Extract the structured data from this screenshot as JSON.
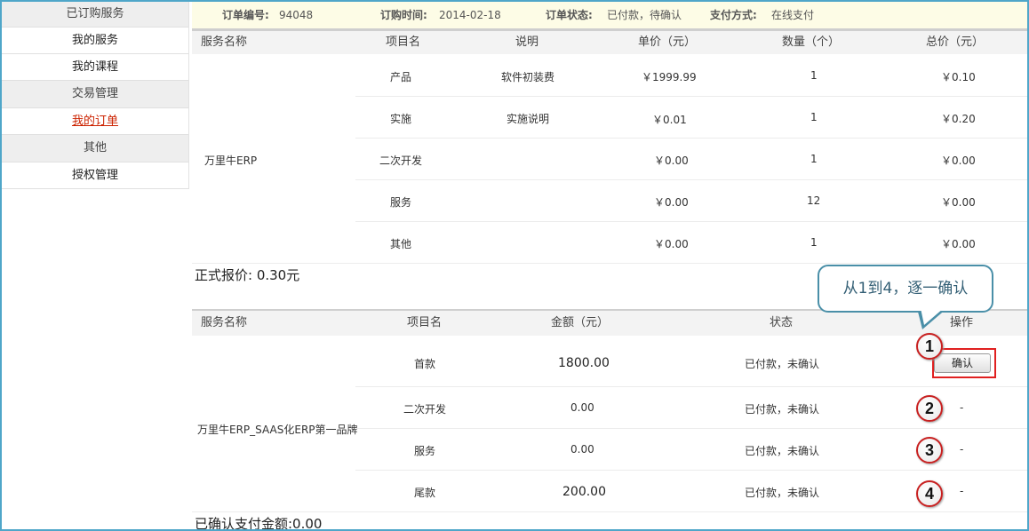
{
  "sidebar": {
    "groups": [
      {
        "title": "已订购服务",
        "items": [
          "我的服务",
          "我的课程"
        ]
      },
      {
        "title": "交易管理",
        "items": [
          "我的订单"
        ]
      },
      {
        "title": "其他",
        "items": [
          "授权管理"
        ]
      }
    ],
    "active_item": "我的订单"
  },
  "order": {
    "id_label": "订单编号:",
    "id": "94048",
    "date_label": "订购时间:",
    "date": "2014-02-18",
    "status_label": "订单状态:",
    "status": "已付款，待确认",
    "pay_label": "支付方式:",
    "pay": "在线支付"
  },
  "items_table": {
    "headers": [
      "服务名称",
      "项目名",
      "说明",
      "单价（元）",
      "数量（个）",
      "总价（元）"
    ],
    "service_name": "万里牛ERP",
    "rows": [
      {
        "item": "产品",
        "desc": "软件初装费",
        "price": "￥1999.99",
        "qty": "1",
        "total": "￥0.10"
      },
      {
        "item": "实施",
        "desc": "实施说明",
        "price": "￥0.01",
        "qty": "1",
        "total": "￥0.20"
      },
      {
        "item": "二次开发",
        "desc": "",
        "price": "￥0.00",
        "qty": "1",
        "total": "￥0.00"
      },
      {
        "item": "服务",
        "desc": "",
        "price": "￥0.00",
        "qty": "12",
        "total": "￥0.00"
      },
      {
        "item": "其他",
        "desc": "",
        "price": "￥0.00",
        "qty": "1",
        "total": "￥0.00"
      }
    ],
    "quote_text": "正式报价: 0.30元"
  },
  "payment_table": {
    "headers": [
      "服务名称",
      "项目名",
      "金额（元）",
      "状态",
      "操作"
    ],
    "service_name": "万里牛ERP_SAAS化ERP第一品牌",
    "rows": [
      {
        "item": "首款",
        "amount": "1800.00",
        "status": "已付款，未确认",
        "action": "确认"
      },
      {
        "item": "二次开发",
        "amount": "0.00",
        "status": "已付款，未确认",
        "action": "-"
      },
      {
        "item": "服务",
        "amount": "0.00",
        "status": "已付款，未确认",
        "action": "-"
      },
      {
        "item": "尾款",
        "amount": "200.00",
        "status": "已付款，未确认",
        "action": "-"
      }
    ],
    "confirmed_text": "已确认支付金额:0.00"
  },
  "annotation": {
    "callout": "从1到4，逐一确认",
    "badges": [
      "1",
      "2",
      "3",
      "4"
    ],
    "colors": {
      "badge_ring": "#c82020",
      "highlight_box": "#e02020",
      "callout_border": "#4a8fa8"
    }
  }
}
